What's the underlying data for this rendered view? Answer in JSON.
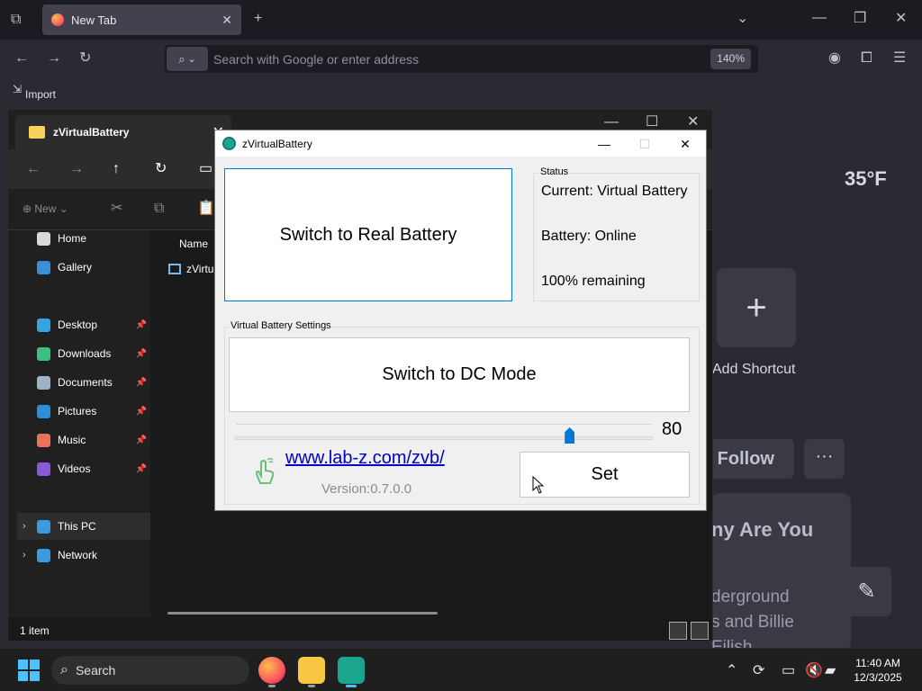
{
  "browser": {
    "tab_title": "New Tab",
    "url_placeholder": "Search with Google or enter address",
    "zoom": "140%",
    "bookmark_import": "Import bookmarks...",
    "weather": "35°F",
    "add_shortcut": "Add Shortcut",
    "follow": "Follow",
    "more": "···",
    "news_title": "ny Are You",
    "news_line1": "derground",
    "news_line2": "s and Billie",
    "news_line3": "Eilish"
  },
  "explorer": {
    "tab_title": "zVirtualBattery",
    "new_label": "New",
    "column_name": "Name",
    "file_name": "zVirtu",
    "status_count": "1 item",
    "sidebar": [
      {
        "label": "Home",
        "icon": "home-icon",
        "color": "#d9d9d9",
        "pinned": false
      },
      {
        "label": "Gallery",
        "icon": "gallery-icon",
        "color": "#3b8ed8",
        "pinned": false
      },
      {
        "label": "Desktop",
        "icon": "desktop-icon",
        "color": "#36a2e0",
        "pinned": true
      },
      {
        "label": "Downloads",
        "icon": "download-icon",
        "color": "#3fbf7f",
        "pinned": true
      },
      {
        "label": "Documents",
        "icon": "documents-icon",
        "color": "#9fb3c8",
        "pinned": true
      },
      {
        "label": "Pictures",
        "icon": "pictures-icon",
        "color": "#2d8fd5",
        "pinned": true
      },
      {
        "label": "Music",
        "icon": "music-icon",
        "color": "#e8735a",
        "pinned": true
      },
      {
        "label": "Videos",
        "icon": "videos-icon",
        "color": "#8a5ad8",
        "pinned": true
      },
      {
        "label": "This PC",
        "icon": "pc-icon",
        "color": "#3a9be0",
        "pinned": false
      },
      {
        "label": "Network",
        "icon": "network-icon",
        "color": "#3a9be0",
        "pinned": false
      }
    ]
  },
  "dialog": {
    "title": "zVirtualBattery",
    "switch_real_label": "Switch to Real Battery",
    "status_group": "Status",
    "status_current": "Current: Virtual Battery",
    "status_battery": "Battery: Online",
    "status_remaining": "100% remaining",
    "settings_group": "Virtual Battery Settings",
    "switch_dc_label": "Switch to DC Mode",
    "slider_value": "80",
    "slider_level": 0.8,
    "link": "www.lab-z.com/zvb/",
    "version": "Version:0.7.0.0",
    "set_label": "Set"
  },
  "taskbar": {
    "search_label": "Search",
    "time": "11:40 AM",
    "date": "12/3/2025"
  },
  "colors": {
    "accent": "#0078d7",
    "link": "#0000c8"
  }
}
